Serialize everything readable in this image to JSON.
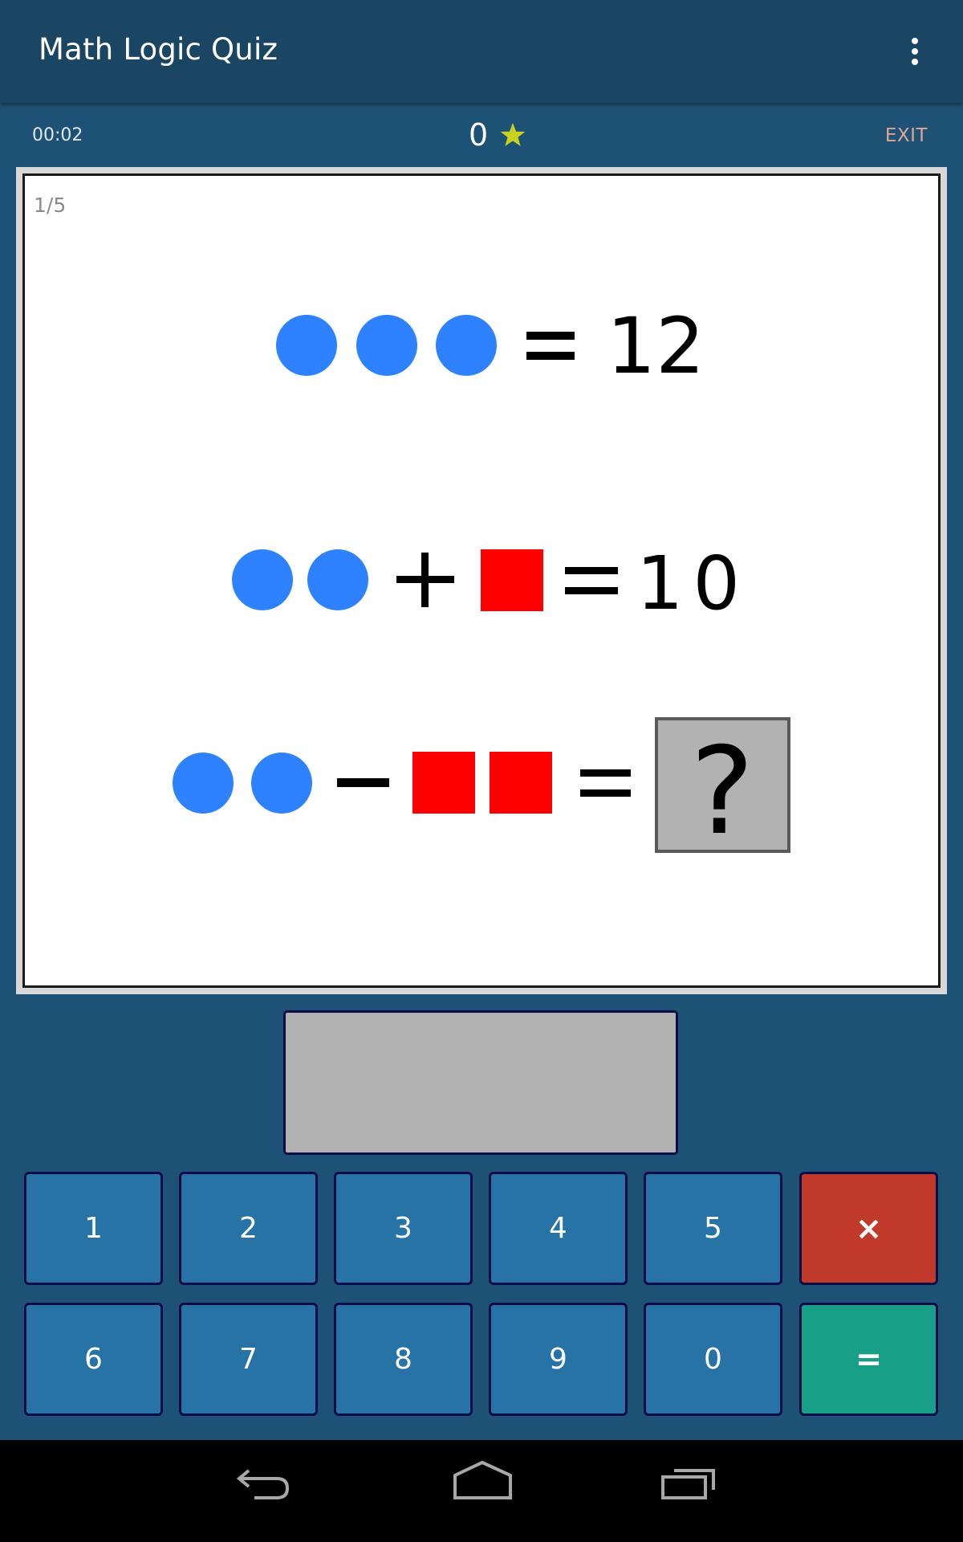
{
  "appbar": {
    "title": "Math Logic Quiz",
    "overflow_icon": "more-vert-icon"
  },
  "status": {
    "timer": "00:02",
    "score": "0",
    "score_icon": "star-icon",
    "exit_label": "EXIT"
  },
  "colors": {
    "background": "#1d5276",
    "appbar": "#1a4563",
    "circle": "#2e82ff",
    "square": "#ff0000",
    "star": "#c8d21e",
    "exit": "#e3a593",
    "key": "#2873a6",
    "clear_key": "#c0392b",
    "equals_key": "#17a086",
    "unknown_box": "#b2b2b2"
  },
  "puzzle": {
    "progress": "1/5",
    "equations": [
      {
        "tokens": [
          "circle",
          "circle",
          "circle",
          "=",
          "12"
        ],
        "operator": "=",
        "result": "12"
      },
      {
        "tokens": [
          "circle",
          "circle",
          "+",
          "square",
          "=",
          "10"
        ],
        "operator_1": "+",
        "operator_2": "=",
        "result": "10"
      },
      {
        "tokens": [
          "circle",
          "circle",
          "−",
          "square",
          "square",
          "=",
          "?"
        ],
        "operator_1": "−",
        "operator_2": "=",
        "result": "?"
      }
    ]
  },
  "answer": {
    "value": ""
  },
  "keypad": {
    "row1": [
      "1",
      "2",
      "3",
      "4",
      "5"
    ],
    "row2": [
      "6",
      "7",
      "8",
      "9",
      "0"
    ],
    "clear_label": "×",
    "equals_label": "="
  },
  "navbar": {
    "back_icon": "back-icon",
    "home_icon": "home-icon",
    "recents_icon": "recents-icon"
  }
}
